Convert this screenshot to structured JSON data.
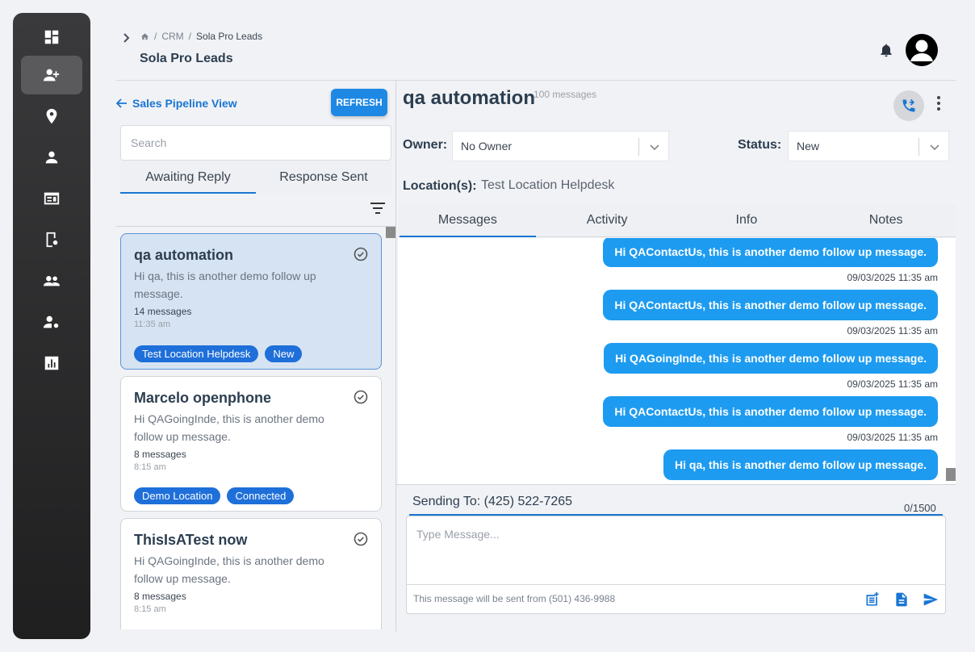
{
  "sidebar": {
    "items": [
      {
        "icon": "dashboard-icon"
      },
      {
        "icon": "leads-icon",
        "active": true
      },
      {
        "icon": "location-pin-icon"
      },
      {
        "icon": "person-icon"
      },
      {
        "icon": "card-icon"
      },
      {
        "icon": "settings-page-icon"
      },
      {
        "icon": "group-icon"
      },
      {
        "icon": "user-settings-icon"
      },
      {
        "icon": "analytics-icon"
      }
    ]
  },
  "header": {
    "breadcrumb": [
      "CRM",
      "Sola Pro Leads"
    ],
    "title": "Sola Pro Leads"
  },
  "left": {
    "back_label": "Sales Pipeline View",
    "refresh_label": "REFRESH",
    "search_placeholder": "Search",
    "tabs": [
      {
        "label": "Awaiting Reply",
        "active": true
      },
      {
        "label": "Response Sent",
        "active": false
      }
    ],
    "leads": [
      {
        "name": "qa automation",
        "message": "Hi qa, this is another demo follow up message.",
        "count": "14 messages",
        "time": "11:35 am",
        "tags": [
          "Test Location Helpdesk",
          "New"
        ],
        "selected": true
      },
      {
        "name": "Marcelo openphone",
        "message": "Hi QAGoingInde, this is another demo follow up message.",
        "count": "8 messages",
        "time": "8:15 am",
        "tags": [
          "Demo Location",
          "Connected"
        ],
        "selected": false
      },
      {
        "name": "ThisIsATest now",
        "message": "Hi QAGoingInde, this is another demo follow up message.",
        "count": "8 messages",
        "time": "8:15 am",
        "tags": [],
        "selected": false
      }
    ]
  },
  "conversation": {
    "title": "qa automation",
    "message_count": "100 messages",
    "owner_label": "Owner:",
    "owner_value": "No Owner",
    "status_label": "Status:",
    "status_value": "New",
    "location_label": "Location(s):",
    "location_value": "Test Location Helpdesk",
    "tabs": [
      {
        "label": "Messages",
        "active": true
      },
      {
        "label": "Activity",
        "active": false
      },
      {
        "label": "Info",
        "active": false
      },
      {
        "label": "Notes",
        "active": false
      }
    ],
    "messages": [
      {
        "text": "Hi QAContactUs, this is another demo follow up message.",
        "timestamp": "09/03/2025 11:35 am"
      },
      {
        "text": "Hi QAContactUs, this is another demo follow up message.",
        "timestamp": "09/03/2025 11:35 am"
      },
      {
        "text": "Hi QAGoingInde, this is another demo follow up message.",
        "timestamp": "09/03/2025 11:35 am"
      },
      {
        "text": "Hi QAContactUs, this is another demo follow up message.",
        "timestamp": "09/03/2025 11:35 am"
      },
      {
        "text": "Hi qa, this is another demo follow up message.",
        "timestamp": ""
      }
    ],
    "sending_to": "Sending To: (425) 522-7265",
    "char_count": "0/1500",
    "compose_placeholder": "Type Message...",
    "from_note": "This message will be sent from (501) 436-9988"
  }
}
